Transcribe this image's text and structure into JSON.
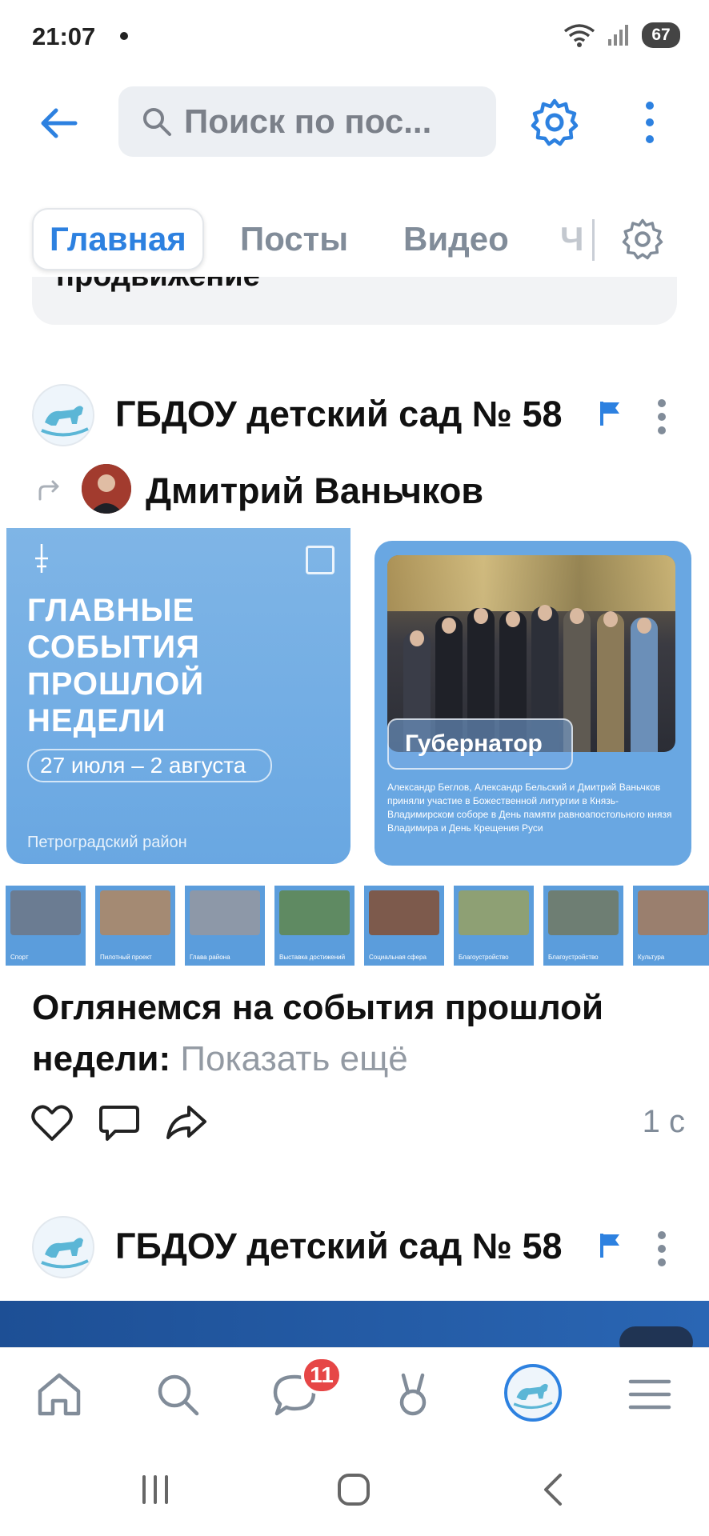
{
  "status_bar": {
    "time": "21:07",
    "battery": "67"
  },
  "search": {
    "placeholder": "Поиск по пос..."
  },
  "tabs": [
    {
      "label": "Главная"
    },
    {
      "label": "Посты"
    },
    {
      "label": "Видео"
    },
    {
      "label": "Ч"
    }
  ],
  "previous_card": {
    "text": "продвижение"
  },
  "posts": [
    {
      "author": "ГБДОУ детский сад № 58",
      "author_fade": "",
      "repost_author": "Дмитрий Ваньчков",
      "image_left": {
        "headline": [
          "ГЛАВНЫЕ",
          "СОБЫТИЯ",
          "ПРОШЛОЙ",
          "НЕДЕЛИ"
        ],
        "dates": "27 июля – 2 августа",
        "district": "Петроградский район"
      },
      "image_right": {
        "label": "Губернатор",
        "caption": "Александр Беглов, Александр Бельский и Дмитрий Ваньчков приняли участие в Божественной литургии в Князь-Владимирском соборе в День памяти равноапостольного князя Владимира и День Крещения Руси"
      },
      "thumbnails": [
        "Спорт",
        "Пилотный проект",
        "Глава района",
        "Выставка достижений",
        "Социальная сфера",
        "Благоустройство",
        "Благоустройство",
        "Культура"
      ],
      "text": "Оглянемся на события прошлой недели:",
      "show_more": "Показать ещё",
      "time": "1 с"
    },
    {
      "author": "ГБДОУ детский сад № 58"
    }
  ],
  "bottom_nav": {
    "messages_badge": "11"
  },
  "colors": {
    "accent": "#2d81e0",
    "badge": "#e64646",
    "muted": "#818c99"
  }
}
